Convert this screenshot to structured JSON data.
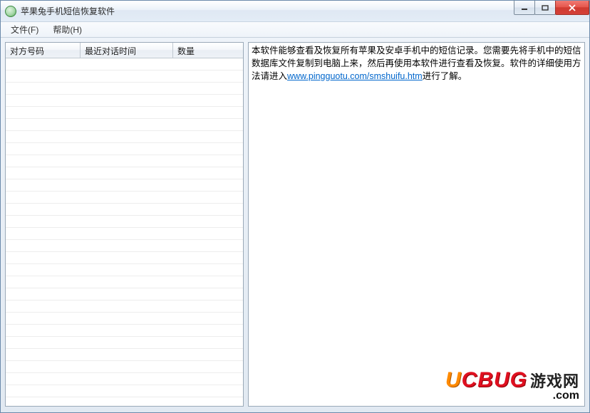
{
  "window": {
    "title": "苹果兔手机短信恢复软件"
  },
  "menu": {
    "file": "文件(F)",
    "help": "帮助(H)"
  },
  "table": {
    "columns": {
      "c1": "对方号码",
      "c2": "最近对话时间",
      "c3": "数量"
    },
    "row_count": 28
  },
  "info": {
    "text_before_link": "本软件能够查看及恢复所有苹果及安卓手机中的短信记录。您需要先将手机中的短信数据库文件复制到电脑上来，然后再使用本软件进行查看及恢复。软件的详细使用方法请进入",
    "link_text": "www.pingguotu.com/smshuifu.htm",
    "text_after_link": "进行了解。"
  },
  "watermark": {
    "brand_u": "U",
    "brand_rest": "CBUG",
    "cn": "游戏网",
    "domain": ".com"
  }
}
